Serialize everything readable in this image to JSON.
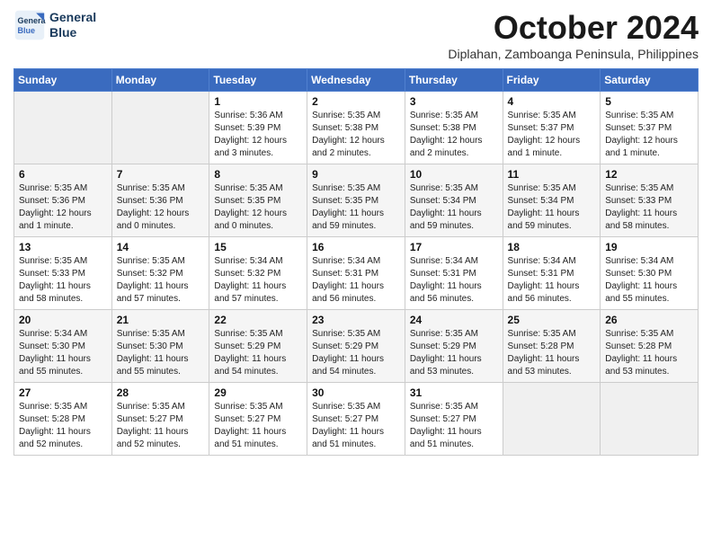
{
  "header": {
    "logo": {
      "line1": "General",
      "line2": "Blue"
    },
    "title": "October 2024",
    "subtitle": "Diplahan, Zamboanga Peninsula, Philippines"
  },
  "weekdays": [
    "Sunday",
    "Monday",
    "Tuesday",
    "Wednesday",
    "Thursday",
    "Friday",
    "Saturday"
  ],
  "weeks": [
    [
      {
        "day": "",
        "empty": true
      },
      {
        "day": "",
        "empty": true
      },
      {
        "day": "1",
        "sunrise": "5:36 AM",
        "sunset": "5:39 PM",
        "daylight": "12 hours and 3 minutes."
      },
      {
        "day": "2",
        "sunrise": "5:35 AM",
        "sunset": "5:38 PM",
        "daylight": "12 hours and 2 minutes."
      },
      {
        "day": "3",
        "sunrise": "5:35 AM",
        "sunset": "5:38 PM",
        "daylight": "12 hours and 2 minutes."
      },
      {
        "day": "4",
        "sunrise": "5:35 AM",
        "sunset": "5:37 PM",
        "daylight": "12 hours and 1 minute."
      },
      {
        "day": "5",
        "sunrise": "5:35 AM",
        "sunset": "5:37 PM",
        "daylight": "12 hours and 1 minute."
      }
    ],
    [
      {
        "day": "6",
        "sunrise": "5:35 AM",
        "sunset": "5:36 PM",
        "daylight": "12 hours and 1 minute."
      },
      {
        "day": "7",
        "sunrise": "5:35 AM",
        "sunset": "5:36 PM",
        "daylight": "12 hours and 0 minutes."
      },
      {
        "day": "8",
        "sunrise": "5:35 AM",
        "sunset": "5:35 PM",
        "daylight": "12 hours and 0 minutes."
      },
      {
        "day": "9",
        "sunrise": "5:35 AM",
        "sunset": "5:35 PM",
        "daylight": "11 hours and 59 minutes."
      },
      {
        "day": "10",
        "sunrise": "5:35 AM",
        "sunset": "5:34 PM",
        "daylight": "11 hours and 59 minutes."
      },
      {
        "day": "11",
        "sunrise": "5:35 AM",
        "sunset": "5:34 PM",
        "daylight": "11 hours and 59 minutes."
      },
      {
        "day": "12",
        "sunrise": "5:35 AM",
        "sunset": "5:33 PM",
        "daylight": "11 hours and 58 minutes."
      }
    ],
    [
      {
        "day": "13",
        "sunrise": "5:35 AM",
        "sunset": "5:33 PM",
        "daylight": "11 hours and 58 minutes."
      },
      {
        "day": "14",
        "sunrise": "5:35 AM",
        "sunset": "5:32 PM",
        "daylight": "11 hours and 57 minutes."
      },
      {
        "day": "15",
        "sunrise": "5:34 AM",
        "sunset": "5:32 PM",
        "daylight": "11 hours and 57 minutes."
      },
      {
        "day": "16",
        "sunrise": "5:34 AM",
        "sunset": "5:31 PM",
        "daylight": "11 hours and 56 minutes."
      },
      {
        "day": "17",
        "sunrise": "5:34 AM",
        "sunset": "5:31 PM",
        "daylight": "11 hours and 56 minutes."
      },
      {
        "day": "18",
        "sunrise": "5:34 AM",
        "sunset": "5:31 PM",
        "daylight": "11 hours and 56 minutes."
      },
      {
        "day": "19",
        "sunrise": "5:34 AM",
        "sunset": "5:30 PM",
        "daylight": "11 hours and 55 minutes."
      }
    ],
    [
      {
        "day": "20",
        "sunrise": "5:34 AM",
        "sunset": "5:30 PM",
        "daylight": "11 hours and 55 minutes."
      },
      {
        "day": "21",
        "sunrise": "5:35 AM",
        "sunset": "5:30 PM",
        "daylight": "11 hours and 55 minutes."
      },
      {
        "day": "22",
        "sunrise": "5:35 AM",
        "sunset": "5:29 PM",
        "daylight": "11 hours and 54 minutes."
      },
      {
        "day": "23",
        "sunrise": "5:35 AM",
        "sunset": "5:29 PM",
        "daylight": "11 hours and 54 minutes."
      },
      {
        "day": "24",
        "sunrise": "5:35 AM",
        "sunset": "5:29 PM",
        "daylight": "11 hours and 53 minutes."
      },
      {
        "day": "25",
        "sunrise": "5:35 AM",
        "sunset": "5:28 PM",
        "daylight": "11 hours and 53 minutes."
      },
      {
        "day": "26",
        "sunrise": "5:35 AM",
        "sunset": "5:28 PM",
        "daylight": "11 hours and 53 minutes."
      }
    ],
    [
      {
        "day": "27",
        "sunrise": "5:35 AM",
        "sunset": "5:28 PM",
        "daylight": "11 hours and 52 minutes."
      },
      {
        "day": "28",
        "sunrise": "5:35 AM",
        "sunset": "5:27 PM",
        "daylight": "11 hours and 52 minutes."
      },
      {
        "day": "29",
        "sunrise": "5:35 AM",
        "sunset": "5:27 PM",
        "daylight": "11 hours and 51 minutes."
      },
      {
        "day": "30",
        "sunrise": "5:35 AM",
        "sunset": "5:27 PM",
        "daylight": "11 hours and 51 minutes."
      },
      {
        "day": "31",
        "sunrise": "5:35 AM",
        "sunset": "5:27 PM",
        "daylight": "11 hours and 51 minutes."
      },
      {
        "day": "",
        "empty": true
      },
      {
        "day": "",
        "empty": true
      }
    ]
  ]
}
